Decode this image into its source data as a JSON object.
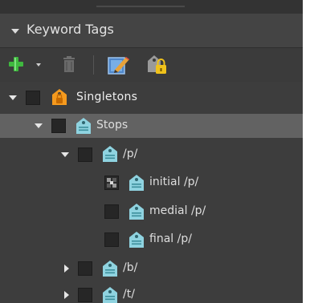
{
  "panel": {
    "title": "Keyword Tags"
  },
  "toolbar": {
    "add_icon": "plus-icon",
    "trash_icon": "trash-icon",
    "edit_icon": "edit-icon",
    "lock_icon": "lock-tag-icon"
  },
  "tree": {
    "singletons": {
      "label": "Singletons",
      "icon": "orange-tag-lock-icon"
    },
    "stops": {
      "label": "Stops",
      "icon": "tag-icon"
    },
    "p": {
      "label": "/p/",
      "icon": "tag-icon"
    },
    "initial_p": {
      "label": "initial /p/",
      "icon": "tag-icon"
    },
    "medial_p": {
      "label": "medial /p/",
      "icon": "tag-icon"
    },
    "final_p": {
      "label": "final /p/",
      "icon": "tag-icon"
    },
    "b": {
      "label": "/b/",
      "icon": "tag-icon"
    },
    "t": {
      "label": "/t/",
      "icon": "tag-icon"
    }
  },
  "colors": {
    "panel_bg": "#3d3d3d",
    "selected_row": "#626262",
    "tag_cyan": "#8fd3e0",
    "tag_orange": "#f59a1e",
    "add_green": "#3fb83f"
  }
}
